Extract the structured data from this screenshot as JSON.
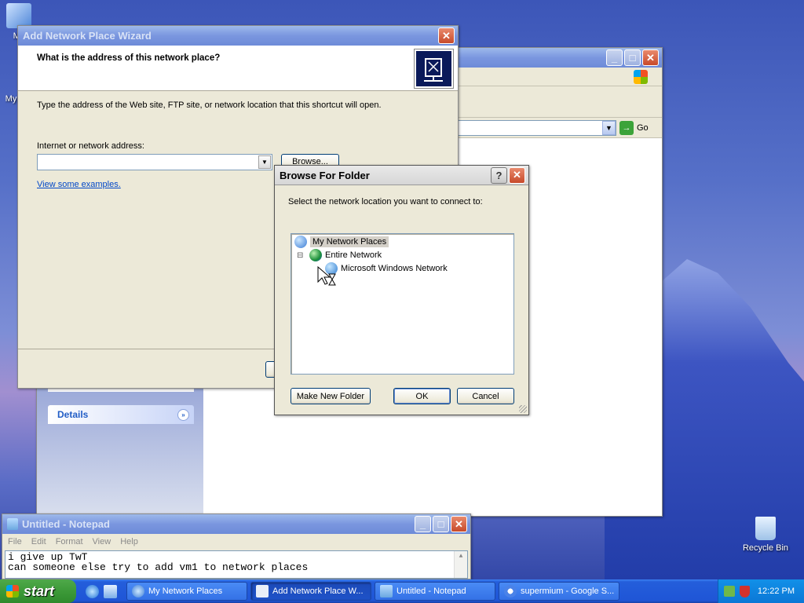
{
  "desktop": {
    "icons": [
      {
        "label": "My"
      },
      {
        "label": "My"
      },
      {
        "label": "Recycle Bin"
      }
    ]
  },
  "explorer": {
    "go_label": "Go",
    "details_label": "Details"
  },
  "wizard": {
    "title": "Add Network Place Wizard",
    "heading": "What is the address of this network place?",
    "instruction": "Type the address of the Web site, FTP site, or network location that this shortcut will open.",
    "address_label": "Internet or network address:",
    "address_value": "",
    "browse_label": "Browse...",
    "examples_link": "View some examples."
  },
  "browse": {
    "title": "Browse For Folder",
    "help_glyph": "?",
    "close_glyph": "✕",
    "prompt": "Select the network location you want to connect to:",
    "tree": {
      "root": "My Network Places",
      "child": "Entire Network",
      "expander": "⊟",
      "grandchild": "Microsoft Windows Network"
    },
    "new_folder_label": "Make New Folder",
    "ok_label": "OK",
    "cancel_label": "Cancel"
  },
  "notepad": {
    "title": "Untitled - Notepad",
    "menu": [
      "File",
      "Edit",
      "Format",
      "View",
      "Help"
    ],
    "lines": [
      "i give up TwT",
      "can someone else try to add vm1 to network places"
    ]
  },
  "taskbar": {
    "start_label": "start",
    "tasks": [
      {
        "label": "My Network Places"
      },
      {
        "label": "Add Network Place W..."
      },
      {
        "label": "Untitled - Notepad"
      },
      {
        "label": "supermium - Google S..."
      }
    ],
    "clock": "12:22 PM"
  },
  "colors": {
    "xp_blue": "#245edb",
    "start_green": "#3c9a38",
    "title_inactive": "#7a96df",
    "link_blue": "#0047c8"
  }
}
